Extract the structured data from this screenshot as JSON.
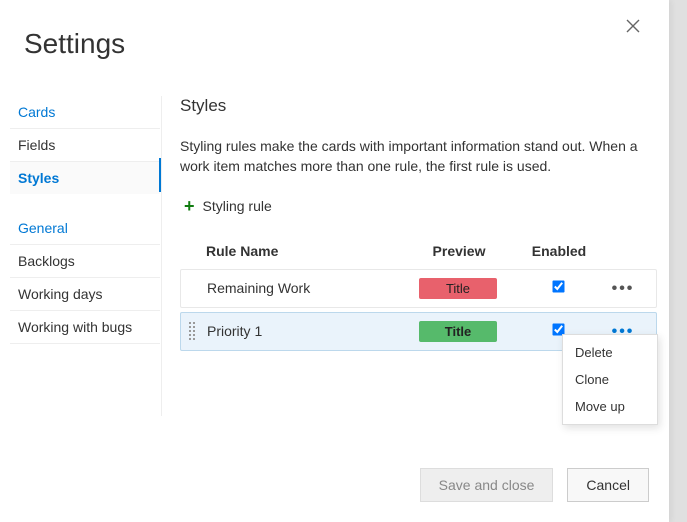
{
  "dialog_title": "Settings",
  "sidebar": {
    "group_cards": "Cards",
    "item_fields": "Fields",
    "item_styles": "Styles",
    "group_general": "General",
    "item_backlogs": "Backlogs",
    "item_working_days": "Working days",
    "item_working_with_bugs": "Working with bugs"
  },
  "content": {
    "section_title": "Styles",
    "description": "Styling rules make the cards with important information stand out. When a work item matches more than one rule, the first rule is used.",
    "add_rule_label": "Styling rule",
    "columns": {
      "name": "Rule Name",
      "preview": "Preview",
      "enabled": "Enabled"
    },
    "rows": [
      {
        "name": "Remaining Work",
        "preview_text": "Title",
        "enabled": true
      },
      {
        "name": "Priority 1",
        "preview_text": "Title",
        "enabled": true
      }
    ]
  },
  "context_menu": {
    "delete": "Delete",
    "clone": "Clone",
    "move_up": "Move up"
  },
  "footer": {
    "save": "Save and close",
    "cancel": "Cancel"
  }
}
